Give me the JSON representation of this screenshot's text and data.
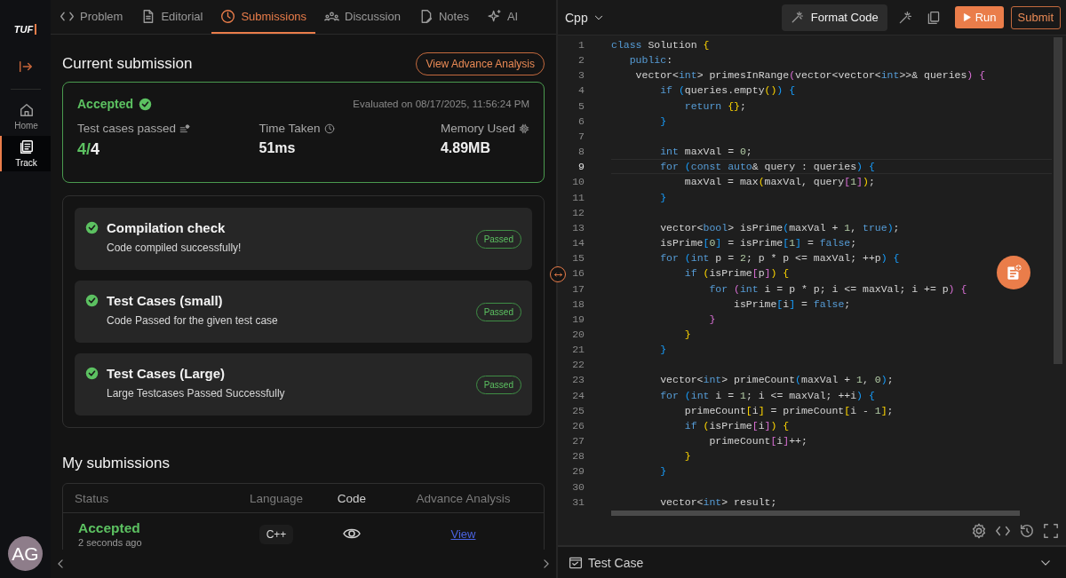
{
  "sidebar": {
    "logo": "TUF",
    "items": [
      {
        "label": "Home",
        "selected": false
      },
      {
        "label": "Track",
        "selected": true
      }
    ],
    "avatar": "AG"
  },
  "tabs": [
    {
      "label": "Problem",
      "selected": false
    },
    {
      "label": "Editorial",
      "selected": false
    },
    {
      "label": "Submissions",
      "selected": true
    },
    {
      "label": "Discussion",
      "selected": false
    },
    {
      "label": "Notes",
      "selected": false
    },
    {
      "label": "AI",
      "selected": false
    }
  ],
  "current_submission": {
    "title": "Current submission",
    "analysis_button": "View Advance Analysis",
    "status": "Accepted",
    "accepted": true,
    "evaluated": "Evaluated on 08/17/2025, 11:56:24 PM",
    "stats": [
      {
        "label": "Test cases passed",
        "value_passed": "4/",
        "value": "4"
      },
      {
        "label": "Time Taken",
        "value": "51ms"
      },
      {
        "label": "Memory Used",
        "value": "4.89MB"
      }
    ]
  },
  "checks": [
    {
      "title": "Compilation check",
      "description": "Code compiled successfully!",
      "badge": "Passed",
      "passed": true
    },
    {
      "title": "Test Cases (small)",
      "description": "Code Passed for the given test case",
      "badge": "Passed",
      "passed": true
    },
    {
      "title": "Test Cases (Large)",
      "description": "Large Testcases Passed Successfully",
      "badge": "Passed",
      "passed": true
    }
  ],
  "my_submissions": {
    "title": "My submissions",
    "columns": [
      "Status",
      "Language",
      "Code",
      "Advance Analysis"
    ],
    "rows": [
      {
        "status": "Accepted",
        "time": "2 seconds ago",
        "language": "C++",
        "link": "View"
      }
    ]
  },
  "editor": {
    "language": "Cpp",
    "format_button": "Format Code",
    "run_button": "Run",
    "submit_button": "Submit",
    "lines": [
      {
        "number": "1",
        "current": false,
        "tokens": [
          {
            "text": "class",
            "kind": "kw"
          },
          {
            "text": " Solution ",
            "kind": "p"
          },
          {
            "text": "{",
            "kind": "y"
          }
        ]
      },
      {
        "number": "2",
        "current": false,
        "tokens": [
          {
            "text": "   public",
            "kind": "kw"
          },
          {
            "text": ":",
            "kind": "p"
          }
        ]
      },
      {
        "number": "3",
        "current": false,
        "tokens": [
          {
            "text": "    vector<",
            "kind": "p"
          },
          {
            "text": "int",
            "kind": "kw"
          },
          {
            "text": "> primesInRange",
            "kind": "p"
          },
          {
            "text": "(",
            "kind": "m"
          },
          {
            "text": "vector<vector<",
            "kind": "p"
          },
          {
            "text": "int",
            "kind": "kw"
          },
          {
            "text": ">>& queries",
            "kind": "p"
          },
          {
            "text": ") {",
            "kind": "m"
          }
        ]
      },
      {
        "number": "4",
        "current": false,
        "tokens": [
          {
            "text": "        if ",
            "kind": "kw"
          },
          {
            "text": "(",
            "kind": "b"
          },
          {
            "text": "queries.empty",
            "kind": "p"
          },
          {
            "text": "()",
            "kind": "y"
          },
          {
            "text": ") {",
            "kind": "b"
          }
        ]
      },
      {
        "number": "5",
        "current": false,
        "tokens": [
          {
            "text": "            return ",
            "kind": "kw"
          },
          {
            "text": "{}",
            "kind": "y"
          },
          {
            "text": ";",
            "kind": "p"
          }
        ]
      },
      {
        "number": "6",
        "current": false,
        "tokens": [
          {
            "text": "        }",
            "kind": "b"
          }
        ]
      },
      {
        "number": "7",
        "current": false
      },
      {
        "number": "8",
        "current": false,
        "tokens": [
          {
            "text": "        int",
            "kind": "kw"
          },
          {
            "text": " maxVal = ",
            "kind": "p"
          },
          {
            "text": "0",
            "kind": "n"
          },
          {
            "text": ";",
            "kind": "p"
          }
        ]
      },
      {
        "number": "9",
        "current": true,
        "tokens": [
          {
            "text": "        for ",
            "kind": "kw"
          },
          {
            "text": "(",
            "kind": "b"
          },
          {
            "text": "const auto",
            "kind": "kw"
          },
          {
            "text": "& query : queries",
            "kind": "p"
          },
          {
            "text": ") {",
            "kind": "b"
          }
        ]
      },
      {
        "number": "10",
        "current": false,
        "tokens": [
          {
            "text": "            maxVal = max",
            "kind": "p"
          },
          {
            "text": "(",
            "kind": "y"
          },
          {
            "text": "maxVal, query",
            "kind": "p"
          },
          {
            "text": "[",
            "kind": "m"
          },
          {
            "text": "1",
            "kind": "n"
          },
          {
            "text": "]",
            "kind": "m"
          },
          {
            "text": ")",
            "kind": "y"
          },
          {
            "text": ";",
            "kind": "p"
          }
        ]
      },
      {
        "number": "11",
        "current": false,
        "tokens": [
          {
            "text": "        }",
            "kind": "b"
          }
        ]
      },
      {
        "number": "12",
        "current": false
      },
      {
        "number": "13",
        "current": false,
        "tokens": [
          {
            "text": "        vector<",
            "kind": "p"
          },
          {
            "text": "bool",
            "kind": "kw"
          },
          {
            "text": "> isPrime",
            "kind": "p"
          },
          {
            "text": "(",
            "kind": "b"
          },
          {
            "text": "maxVal + ",
            "kind": "p"
          },
          {
            "text": "1",
            "kind": "n"
          },
          {
            "text": ", ",
            "kind": "p"
          },
          {
            "text": "true",
            "kind": "kw"
          },
          {
            "text": ")",
            "kind": "b"
          },
          {
            "text": ";",
            "kind": "p"
          }
        ]
      },
      {
        "number": "14",
        "current": false,
        "tokens": [
          {
            "text": "        isPrime",
            "kind": "p"
          },
          {
            "text": "[",
            "kind": "b"
          },
          {
            "text": "0",
            "kind": "n"
          },
          {
            "text": "]",
            "kind": "b"
          },
          {
            "text": " = isPrime",
            "kind": "p"
          },
          {
            "text": "[",
            "kind": "b"
          },
          {
            "text": "1",
            "kind": "n"
          },
          {
            "text": "]",
            "kind": "b"
          },
          {
            "text": " = ",
            "kind": "p"
          },
          {
            "text": "false",
            "kind": "kw"
          },
          {
            "text": ";",
            "kind": "p"
          }
        ]
      },
      {
        "number": "15",
        "current": false,
        "tokens": [
          {
            "text": "        for ",
            "kind": "kw"
          },
          {
            "text": "(",
            "kind": "b"
          },
          {
            "text": "int",
            "kind": "kw"
          },
          {
            "text": " p = ",
            "kind": "p"
          },
          {
            "text": "2",
            "kind": "n"
          },
          {
            "text": "; p * p <= maxVal; ++p",
            "kind": "p"
          },
          {
            "text": ") {",
            "kind": "b"
          }
        ]
      },
      {
        "number": "16",
        "current": false,
        "tokens": [
          {
            "text": "            if ",
            "kind": "kw"
          },
          {
            "text": "(",
            "kind": "y"
          },
          {
            "text": "isPrime",
            "kind": "p"
          },
          {
            "text": "[",
            "kind": "m"
          },
          {
            "text": "p",
            "kind": "p"
          },
          {
            "text": "]",
            "kind": "m"
          },
          {
            "text": ") {",
            "kind": "y"
          }
        ]
      },
      {
        "number": "17",
        "current": false,
        "tokens": [
          {
            "text": "                for ",
            "kind": "kw"
          },
          {
            "text": "(",
            "kind": "m"
          },
          {
            "text": "int",
            "kind": "kw"
          },
          {
            "text": " i = p * p; i <= maxVal; i += p",
            "kind": "p"
          },
          {
            "text": ") {",
            "kind": "m"
          }
        ]
      },
      {
        "number": "18",
        "current": false,
        "tokens": [
          {
            "text": "                    isPrime",
            "kind": "p"
          },
          {
            "text": "[",
            "kind": "b"
          },
          {
            "text": "i",
            "kind": "p"
          },
          {
            "text": "]",
            "kind": "b"
          },
          {
            "text": " = ",
            "kind": "p"
          },
          {
            "text": "false",
            "kind": "kw"
          },
          {
            "text": ";",
            "kind": "p"
          }
        ]
      },
      {
        "number": "19",
        "current": false,
        "tokens": [
          {
            "text": "                }",
            "kind": "m"
          }
        ]
      },
      {
        "number": "20",
        "current": false,
        "tokens": [
          {
            "text": "            }",
            "kind": "y"
          }
        ]
      },
      {
        "number": "21",
        "current": false,
        "tokens": [
          {
            "text": "        }",
            "kind": "b"
          }
        ]
      },
      {
        "number": "22",
        "current": false
      },
      {
        "number": "23",
        "current": false,
        "tokens": [
          {
            "text": "        vector<",
            "kind": "p"
          },
          {
            "text": "int",
            "kind": "kw"
          },
          {
            "text": "> primeCount",
            "kind": "p"
          },
          {
            "text": "(",
            "kind": "b"
          },
          {
            "text": "maxVal + ",
            "kind": "p"
          },
          {
            "text": "1",
            "kind": "n"
          },
          {
            "text": ", ",
            "kind": "p"
          },
          {
            "text": "0",
            "kind": "n"
          },
          {
            "text": ")",
            "kind": "b"
          },
          {
            "text": ";",
            "kind": "p"
          }
        ]
      },
      {
        "number": "24",
        "current": false,
        "tokens": [
          {
            "text": "        for ",
            "kind": "kw"
          },
          {
            "text": "(",
            "kind": "b"
          },
          {
            "text": "int",
            "kind": "kw"
          },
          {
            "text": " i = ",
            "kind": "p"
          },
          {
            "text": "1",
            "kind": "n"
          },
          {
            "text": "; i <= maxVal; ++i",
            "kind": "p"
          },
          {
            "text": ") {",
            "kind": "b"
          }
        ]
      },
      {
        "number": "25",
        "current": false,
        "tokens": [
          {
            "text": "            primeCount",
            "kind": "p"
          },
          {
            "text": "[",
            "kind": "y"
          },
          {
            "text": "i",
            "kind": "p"
          },
          {
            "text": "]",
            "kind": "y"
          },
          {
            "text": " = primeCount",
            "kind": "p"
          },
          {
            "text": "[",
            "kind": "y"
          },
          {
            "text": "i - ",
            "kind": "p"
          },
          {
            "text": "1",
            "kind": "n"
          },
          {
            "text": "]",
            "kind": "y"
          },
          {
            "text": ";",
            "kind": "p"
          }
        ]
      },
      {
        "number": "26",
        "current": false,
        "tokens": [
          {
            "text": "            if ",
            "kind": "kw"
          },
          {
            "text": "(",
            "kind": "y"
          },
          {
            "text": "isPrime",
            "kind": "p"
          },
          {
            "text": "[",
            "kind": "m"
          },
          {
            "text": "i",
            "kind": "p"
          },
          {
            "text": "]",
            "kind": "m"
          },
          {
            "text": ") {",
            "kind": "y"
          }
        ]
      },
      {
        "number": "27",
        "current": false,
        "tokens": [
          {
            "text": "                primeCount",
            "kind": "p"
          },
          {
            "text": "[",
            "kind": "m"
          },
          {
            "text": "i",
            "kind": "p"
          },
          {
            "text": "]",
            "kind": "m"
          },
          {
            "text": "++;",
            "kind": "p"
          }
        ]
      },
      {
        "number": "28",
        "current": false,
        "tokens": [
          {
            "text": "            }",
            "kind": "y"
          }
        ]
      },
      {
        "number": "29",
        "current": false,
        "tokens": [
          {
            "text": "        }",
            "kind": "b"
          }
        ]
      },
      {
        "number": "30",
        "current": false
      },
      {
        "number": "31",
        "current": false,
        "tokens": [
          {
            "text": "        vector<",
            "kind": "p"
          },
          {
            "text": "int",
            "kind": "kw"
          },
          {
            "text": "> result;",
            "kind": "p"
          }
        ]
      }
    ]
  },
  "test_case_panel": {
    "title": "Test Case"
  }
}
